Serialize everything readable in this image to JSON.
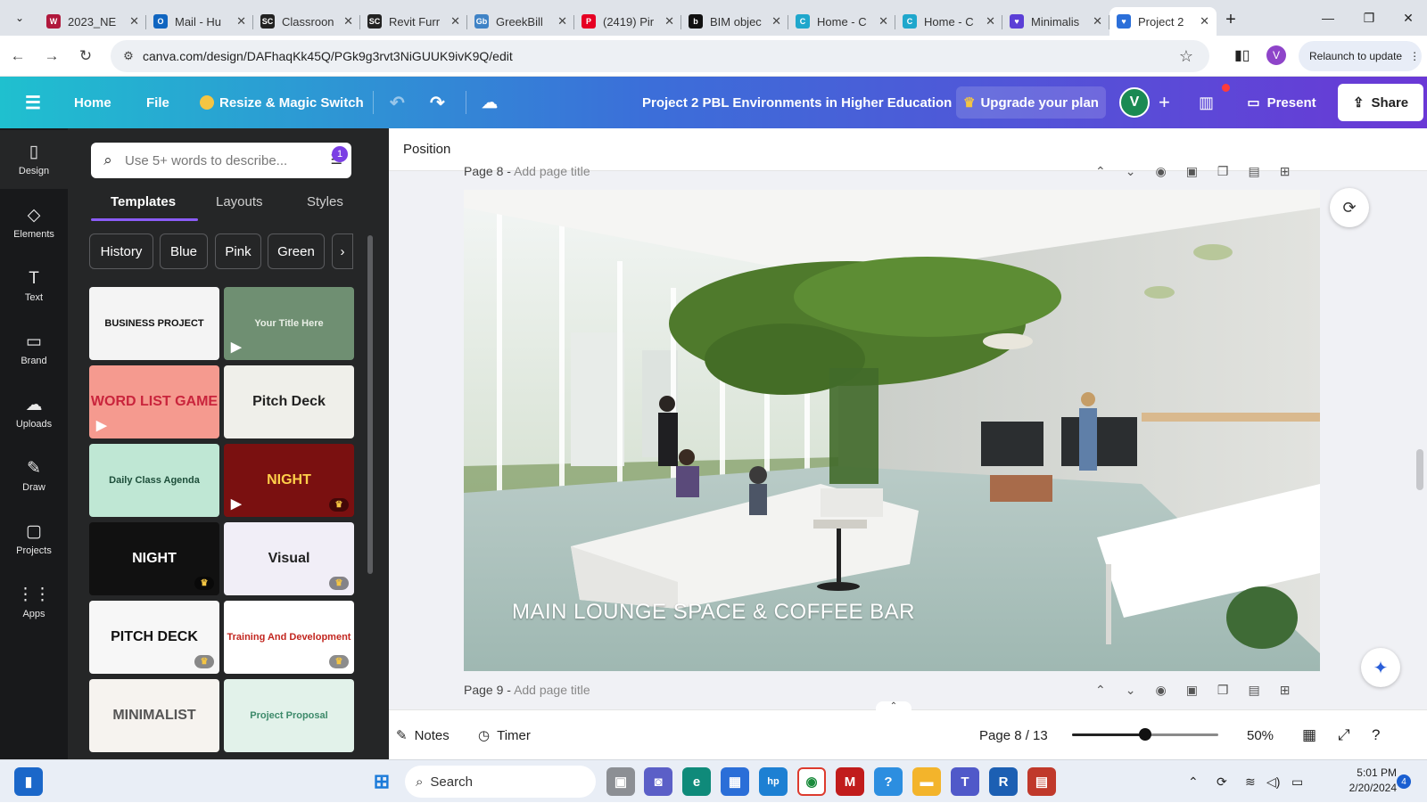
{
  "browser": {
    "tabs": [
      {
        "title": "2023_NE",
        "color": "#b0183c",
        "glyph": "W"
      },
      {
        "title": "Mail - Hu",
        "color": "#1065c0",
        "glyph": "O"
      },
      {
        "title": "Classroon",
        "color": "#222222",
        "glyph": "SC"
      },
      {
        "title": "Revit Furr",
        "color": "#222222",
        "glyph": "SC"
      },
      {
        "title": "GreekBill",
        "color": "#3f83c6",
        "glyph": "Gb"
      },
      {
        "title": "(2419) Pir",
        "color": "#e60023",
        "glyph": "P"
      },
      {
        "title": "BIM objec",
        "color": "#111111",
        "glyph": "b"
      },
      {
        "title": "Home - C",
        "color": "#1fa7cc",
        "glyph": "C"
      },
      {
        "title": "Home - C",
        "color": "#1fa7cc",
        "glyph": "C"
      },
      {
        "title": "Minimalis",
        "color": "#5b3fd6",
        "glyph": "♥"
      },
      {
        "title": "Project 2",
        "color": "#2b6fd9",
        "glyph": "♥"
      }
    ],
    "url": "canva.com/design/DAFhaqKk45Q/PGk9g3rvt3NiGUUK9ivK9Q/edit",
    "relaunch_label": "Relaunch to update",
    "profile_initial": "V"
  },
  "canva": {
    "home_label": "Home",
    "file_label": "File",
    "resize_label": "Resize & Magic Switch",
    "doc_title": "Project 2 PBL Environments in Higher Education",
    "upgrade_label": "Upgrade your plan",
    "avatar_initial": "V",
    "present_label": "Present",
    "share_label": "Share"
  },
  "leftnav": [
    {
      "label": "Design",
      "icon": "▯"
    },
    {
      "label": "Elements",
      "icon": "◇"
    },
    {
      "label": "Text",
      "icon": "T"
    },
    {
      "label": "Brand",
      "icon": "▭"
    },
    {
      "label": "Uploads",
      "icon": "☁"
    },
    {
      "label": "Draw",
      "icon": "✎"
    },
    {
      "label": "Projects",
      "icon": "▢"
    },
    {
      "label": "Apps",
      "icon": "⋮⋮"
    }
  ],
  "panel": {
    "search_placeholder": "Use 5+ words to describe...",
    "filter_count": "1",
    "tabs": [
      "Templates",
      "Layouts",
      "Styles"
    ],
    "chips": [
      "History",
      "Blue",
      "Pink",
      "Green"
    ],
    "templates": [
      {
        "text": "BUSINESS PROJECT",
        "bg": "#f4f4f4",
        "fg": "#111111"
      },
      {
        "text": "Your Title Here",
        "bg": "#6f8f72",
        "fg": "#e9efe6"
      },
      {
        "text": "WORD LIST GAME",
        "bg": "#f59a8f",
        "fg": "#c9243c"
      },
      {
        "text": "Pitch Deck",
        "bg": "#efefea",
        "fg": "#222222"
      },
      {
        "text": "Daily Class Agenda",
        "bg": "#bfe7d4",
        "fg": "#1d4e3a"
      },
      {
        "text": "NIGHT",
        "bg": "#7a1010",
        "fg": "#ffcf4a"
      },
      {
        "text": "NIGHT",
        "bg": "#111111",
        "fg": "#ffffff"
      },
      {
        "text": "Visual",
        "bg": "#f1eef7",
        "fg": "#222222"
      },
      {
        "text": "PITCH DECK",
        "bg": "#f7f7f7",
        "fg": "#111111"
      },
      {
        "text": "Training And Development",
        "bg": "#ffffff",
        "fg": "#c2261f"
      },
      {
        "text": "MINIMALIST",
        "bg": "#f6f3ef",
        "fg": "#555555"
      },
      {
        "text": "Project Proposal",
        "bg": "#e2f2ea",
        "fg": "#3d8a6a"
      }
    ]
  },
  "editor": {
    "position_label": "Position",
    "page8_title": "Page 8 -",
    "page8_placeholder": "Add page title",
    "page9_title": "Page 9 -",
    "page9_placeholder": "Add page title",
    "slide_text": "MAIN LOUNGE SPACE & COFFEE BAR"
  },
  "footer": {
    "notes_label": "Notes",
    "timer_label": "Timer",
    "page_indicator": "Page 8 / 13",
    "zoom_label": "50%",
    "zoom_fraction": 0.5
  },
  "taskbar": {
    "search_label": "Search",
    "time": "5:01 PM",
    "date": "2/20/2024",
    "notification_count": "4"
  }
}
